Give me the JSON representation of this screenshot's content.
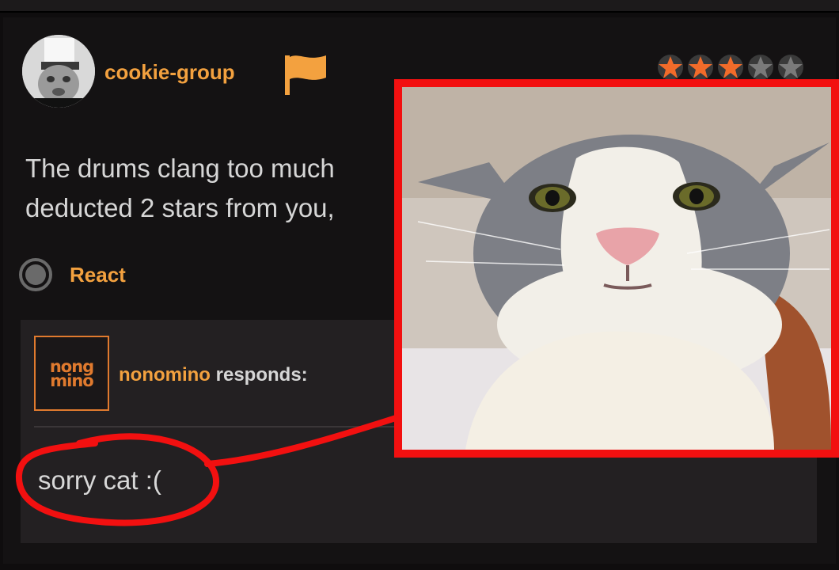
{
  "review": {
    "username": "cookie-group",
    "avatar_icon": "user-avatar",
    "flag_icon": "flag-icon",
    "rating": 3,
    "rating_max": 5,
    "text_line_1": "The drums clang too much",
    "text_line_2": "deducted 2 stars from you,",
    "react_label": "React"
  },
  "response": {
    "logo_line_1": "nong",
    "logo_line_2": "mino",
    "responder_name": "nonomino",
    "responds_suffix": "responds:",
    "text": "sorry cat :("
  },
  "colors": {
    "accent": "#f3a13f",
    "star_active": "#f26b2a",
    "star_inactive": "#7a7a7a",
    "annotation_red": "#f21010",
    "background": "#141213",
    "response_bg": "#232022"
  }
}
